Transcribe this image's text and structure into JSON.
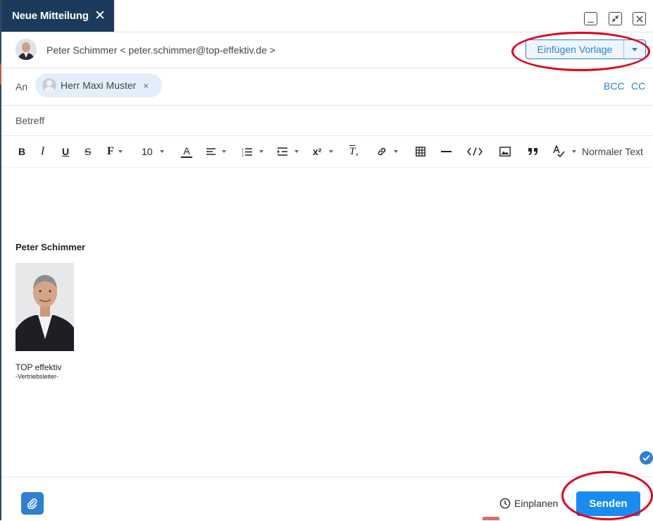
{
  "window": {
    "tab_title": "Neue Mitteilung",
    "tab_close_icon": "close-icon",
    "buttons": [
      "minimize-icon",
      "shrink-icon",
      "close-icon"
    ]
  },
  "from": {
    "sender": "Peter Schimmer < peter.schimmer@top-effektiv.de >",
    "template_button": "Einfügen Vorlage"
  },
  "to": {
    "label": "An",
    "recipient": "Herr Maxi Muster",
    "remove_glyph": "×",
    "bcc": "BCC",
    "cc": "CC"
  },
  "subject": {
    "placeholder": "Betreff",
    "value": ""
  },
  "toolbar": {
    "bold": "B",
    "italic": "I",
    "underline": "U",
    "strike": "S",
    "font": "F",
    "font_size": "10",
    "font_color": "A",
    "superscript": "x²",
    "clear_format": "T",
    "format": "Normaler Text"
  },
  "signature": {
    "name": "Peter Schimmer",
    "company": "TOP effektiv",
    "role": "-Vertriebsleiter-"
  },
  "footer": {
    "schedule": "Einplanen",
    "send": "Senden"
  },
  "colors": {
    "tab_bg": "#1b3a5c",
    "accent": "#2f80d1",
    "send": "#1a8cf0",
    "annotation": "#e0001a"
  }
}
